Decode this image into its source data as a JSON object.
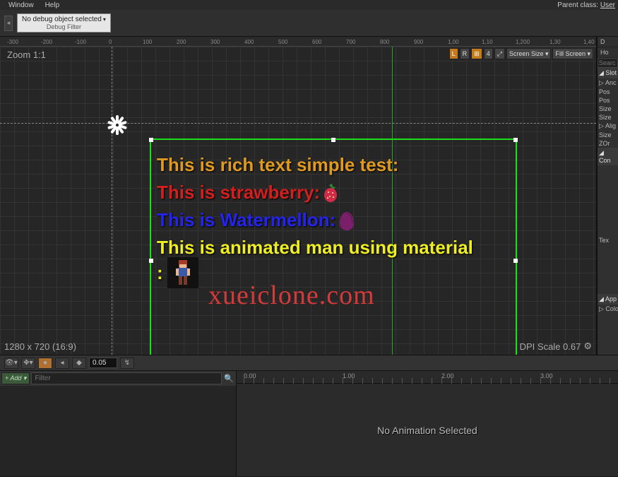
{
  "menu": {
    "window": "Window",
    "help": "Help",
    "parent_label": "Parent class:",
    "parent_value": "User"
  },
  "debug": {
    "label": "No debug object selected",
    "sub": "Debug Filter"
  },
  "ruler_ticks": [
    "-300",
    "-200",
    "-100",
    "0",
    "100",
    "200",
    "300",
    "400",
    "500",
    "600",
    "700",
    "800",
    "900",
    "1,00",
    "1,10",
    "1,200",
    "1,30",
    "1,40"
  ],
  "viewport": {
    "zoom": "Zoom 1:1",
    "res": "1280 x 720 (16:9)",
    "dpi": "DPI Scale 0.67",
    "controls": {
      "l": "L",
      "r": "R",
      "grid": "⊞",
      "val": "4",
      "screensize": "Screen Size ▾",
      "fill": "Fill Screen ▾"
    }
  },
  "richtext": {
    "l1": "This is rich text simple test:",
    "l2": "This is strawberry: ",
    "l3": "This is Watermellon: ",
    "l4": "This is animated man using material",
    "colon": ":"
  },
  "watermark": "xueiclone.com",
  "details": {
    "drop": "D",
    "home": "Ho",
    "search": "Searc",
    "slot": "Slot",
    "anchors": "Anc",
    "rows": [
      "Pos",
      "Pos",
      "Size",
      "Size"
    ],
    "align": "Alig",
    "rows2": [
      "Size",
      "ZOr"
    ],
    "content": "Con",
    "text": "Tex",
    "appear": "App",
    "color": "Colo"
  },
  "anim": {
    "playrate": "0.05",
    "add": "+ Add ▾",
    "filter": "Filter",
    "timeline": [
      "0.00",
      "1.00",
      "2.00",
      "3.00"
    ],
    "empty": "No Animation Selected"
  }
}
